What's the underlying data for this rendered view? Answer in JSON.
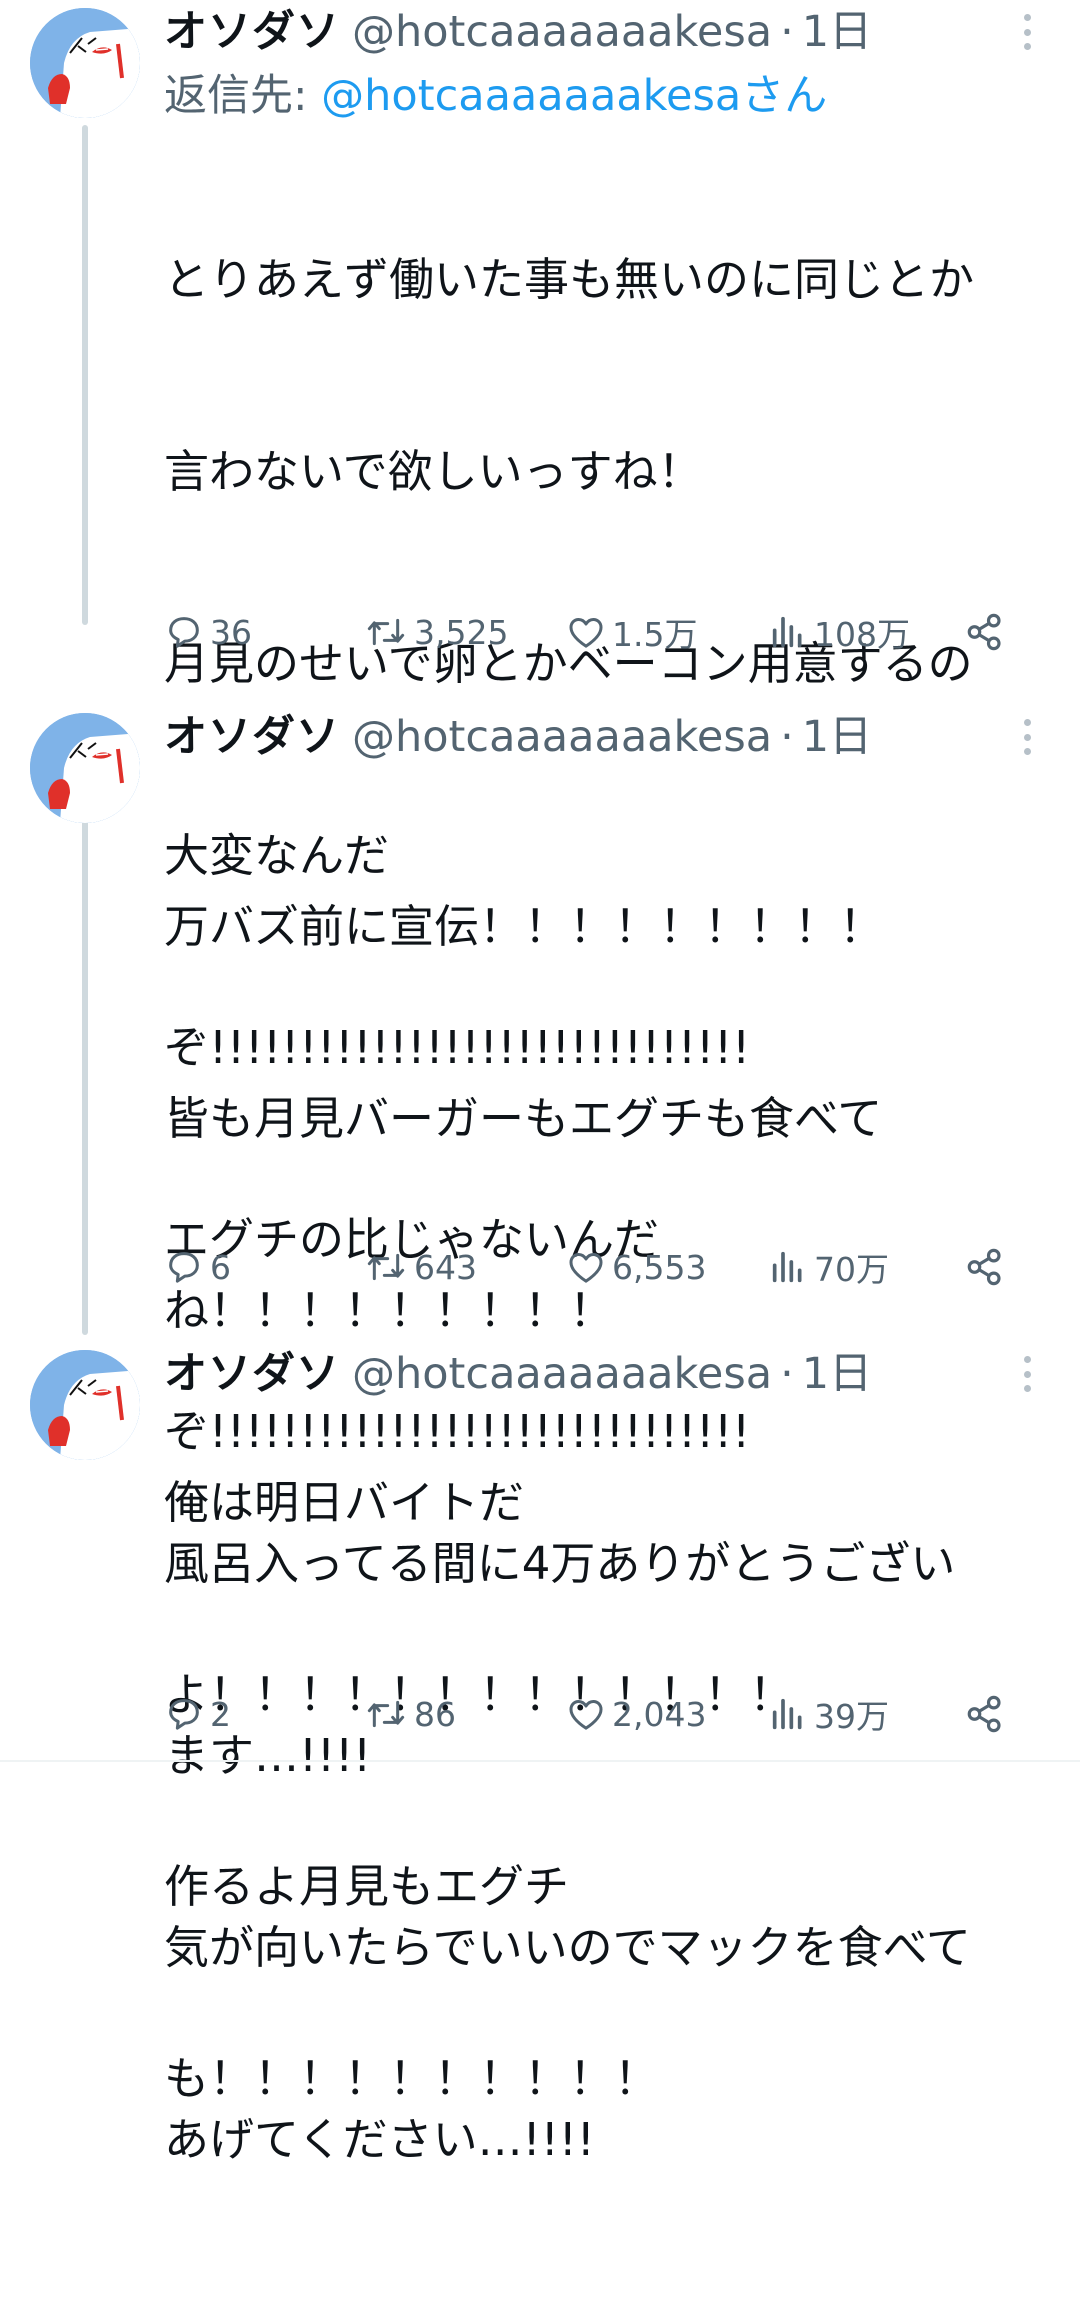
{
  "tweets": [
    {
      "display_name": "オソダソ",
      "handle": "@hotcaaaaaaakesa",
      "separator": "·",
      "time": "1日",
      "reply_label": "返信先:",
      "reply_mention": "@hotcaaaaaaakesaさん",
      "lines": [
        "とりあえず働いた事も無いのに同じとか",
        "言わないで欲しいっすね！",
        "月見のせいで卵とかベーコン用意するの",
        "大変なんだ",
        "ぞ!!!!!!!!!!!!!!!!!!!!!!!!!!!!!!",
        "エグチの比じゃないんだ",
        "ぞ!!!!!!!!!!!!!!!!!!!!!!!!!!!!!!"
      ],
      "stats": {
        "replies": "36",
        "retweets": "3,525",
        "likes": "1.5万",
        "views": "108万"
      }
    },
    {
      "display_name": "オソダソ",
      "handle": "@hotcaaaaaaakesa",
      "separator": "·",
      "time": "1日",
      "lines": [
        "万バズ前に宣伝！！！！！！！！！",
        "皆も月見バーガーもエグチも食べて",
        "ね！！！！！！！！！",
        "俺は明日バイトだ",
        "よ！！！！！！！！！！！！！",
        "作るよ月見もエグチ",
        "も！！！！！！！！！！"
      ],
      "stats": {
        "replies": "6",
        "retweets": "643",
        "likes": "6,553",
        "views": "70万"
      }
    },
    {
      "display_name": "オソダソ",
      "handle": "@hotcaaaaaaakesa",
      "separator": "·",
      "time": "1日",
      "lines": [
        "風呂入ってる間に4万ありがとうござい",
        "ます…!!!!",
        "気が向いたらでいいのでマックを食べて",
        "あげてください…!!!!"
      ],
      "stats": {
        "replies": "2",
        "retweets": "86",
        "likes": "2,043",
        "views": "39万"
      }
    }
  ],
  "colors": {
    "text": "#0f1419",
    "secondary": "#536471",
    "link": "#1d9bf0",
    "thread_line": "#cfd9de",
    "avatar_bg": "#7fb3e8"
  },
  "icons": [
    "reply-icon",
    "retweet-icon",
    "like-icon",
    "views-icon",
    "share-icon",
    "more-icon"
  ]
}
